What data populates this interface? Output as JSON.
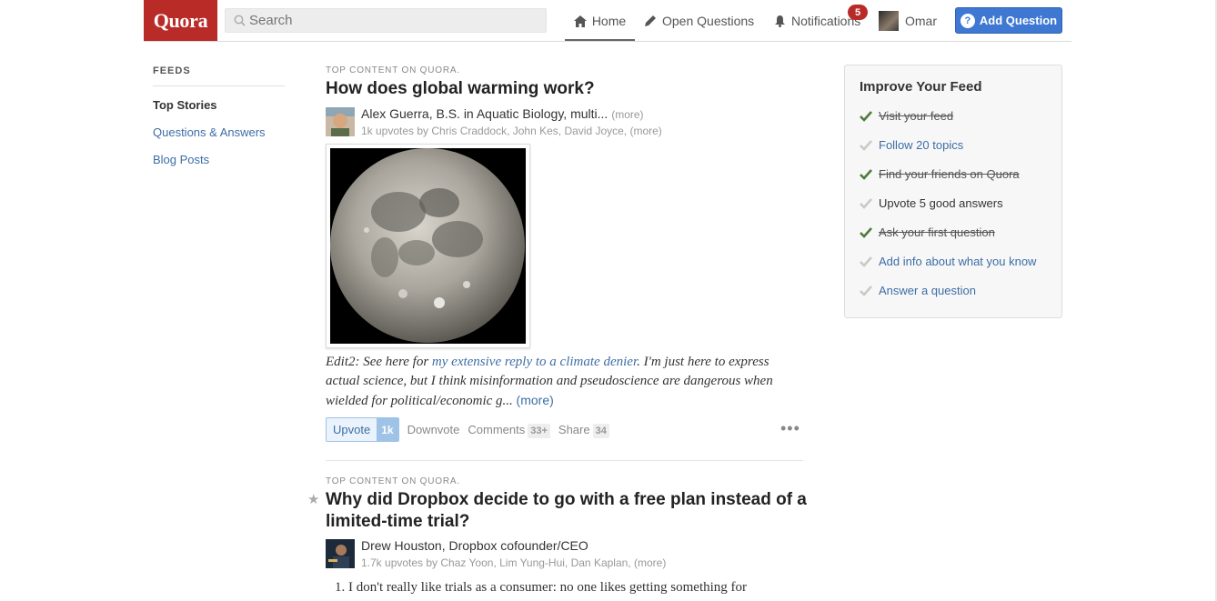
{
  "header": {
    "logo": "Quora",
    "search_placeholder": "Search",
    "nav": {
      "home": "Home",
      "open_questions": "Open Questions",
      "notifications": "Notifications",
      "notifications_count": "5",
      "user": "Omar"
    },
    "add_question": "Add Question",
    "colors": {
      "brand": "#b92b27",
      "accent": "#3e78d3"
    }
  },
  "sidebar": {
    "heading": "FEEDS",
    "items": [
      {
        "label": "Top Stories"
      },
      {
        "label": "Questions & Answers"
      },
      {
        "label": "Blog Posts"
      }
    ]
  },
  "stories": [
    {
      "label": "TOP CONTENT ON QUORA.",
      "title": "How does global warming work?",
      "author": "Alex Guerra, B.S. in Aquatic Biology, multi...",
      "author_more": "(more)",
      "meta": "1k upvotes by Chris Craddock, John Kes, David Joyce, (more)",
      "image": "moon-photo",
      "excerpt_pre": "Edit2: See here for ",
      "excerpt_link": "my extensive reply to a climate denier",
      "excerpt_post": ". I'm just here to express actual science, but I think misinformation and pseudoscience are dangerous when wielded for political/economic g...",
      "excerpt_more": "(more)",
      "upvote_label": "Upvote",
      "upvote_count": "1k",
      "downvote": "Downvote",
      "comments": "Comments",
      "comments_count": "33+",
      "share": "Share",
      "share_count": "34"
    },
    {
      "label": "TOP CONTENT ON QUORA.",
      "title_line1": "Why did Dropbox decide to go with a free plan instead of a",
      "title_line2": "limited-time trial?",
      "author": "Drew Houston, Dropbox cofounder/CEO",
      "meta": "1.7k upvotes by Chaz Yoon, Lim Yung-Hui, Dan Kaplan, (more)",
      "list_first": "1.  I don't really like trials as a consumer: no one likes getting something for"
    }
  ],
  "improve_feed": {
    "title": "Improve Your Feed",
    "tasks": [
      {
        "label": "Visit your feed",
        "done": true
      },
      {
        "label": "Follow 20 topics",
        "done": false
      },
      {
        "label": "Find your friends on Quora",
        "done": true
      },
      {
        "label": "Upvote 5 good answers",
        "done": false
      },
      {
        "label": "Ask your first question",
        "done": true
      },
      {
        "label": "Add info about what you know",
        "done": false
      },
      {
        "label": "Answer a question",
        "done": false
      }
    ]
  }
}
